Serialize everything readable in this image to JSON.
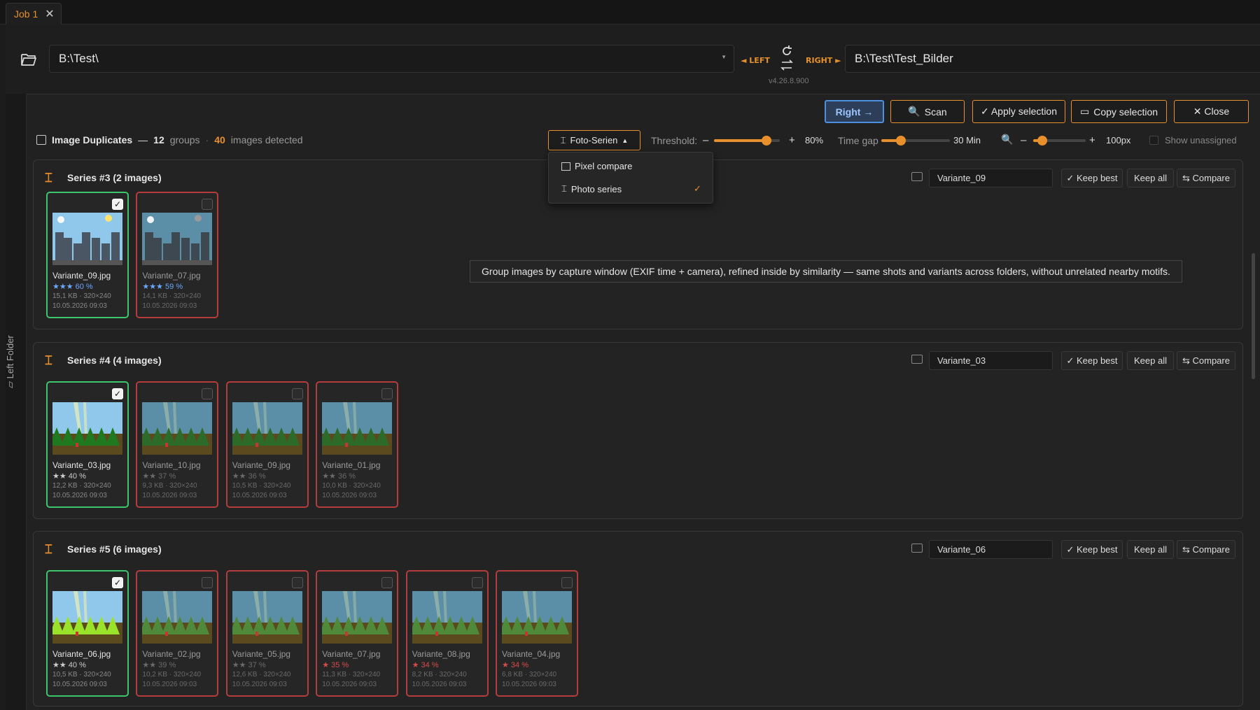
{
  "tab": {
    "label": "Job 1",
    "close": "✕"
  },
  "left_path": "B:\\Test\\",
  "left_label": "◄ LEFT",
  "right_label": "RIGHT ►",
  "right_path": "B:\\Test\\Test_Bilder",
  "version": "v4.26.8.900",
  "side_label": "Left Folder",
  "toolbar": {
    "direction": "Right →",
    "scan": "Scan",
    "apply": "✓ Apply selection",
    "copy": "Copy selection",
    "close": "✕ Close"
  },
  "summary": {
    "title": "Image Duplicates",
    "dash": "—",
    "groups_count": "12",
    "groups_label": "groups",
    "dot": "·",
    "images_count": "40",
    "images_label": "images detected"
  },
  "mode_select": {
    "value": "Foto-Serien"
  },
  "threshold": {
    "label": "Threshold:",
    "minus": "–",
    "plus": "+",
    "value": "80%",
    "fraction": 0.8
  },
  "timegap": {
    "label": "Time gap",
    "value": "30 Min"
  },
  "zoom": {
    "minus": "–",
    "plus": "+",
    "value": "100px"
  },
  "show_unassigned": "Show unassigned",
  "dropdown": {
    "items": [
      {
        "label": "Pixel compare"
      },
      {
        "label": "Photo series",
        "check": "✓"
      }
    ]
  },
  "tooltip": "Group images by capture window (EXIF time + camera), refined inside by similarity — same shots and variants across folders, without unrelated nearby motifs.",
  "group_buttons": {
    "keep_best": "✓ Keep best",
    "keep_all": "Keep all",
    "compare": "⇆ Compare"
  },
  "groups": [
    {
      "title": "Series #3 (2 images)",
      "name": "Variante_09",
      "thumbs": [
        {
          "file": "Variante_09.jpg",
          "rating": "★★★ 60 %",
          "size": "15,1 KB · 320×240",
          "date": "10.05.2026 09:03"
        },
        {
          "file": "Variante_07.jpg",
          "rating": "★★★ 59 %",
          "size": "14,1 KB · 320×240",
          "date": "10.05.2026 09:03"
        }
      ]
    },
    {
      "title": "Series #4 (4 images)",
      "name": "Variante_03",
      "thumbs": [
        {
          "file": "Variante_03.jpg",
          "rating": "★★ 40 %",
          "size": "12,2 KB · 320×240",
          "date": "10.05.2026 09:03"
        },
        {
          "file": "Variante_10.jpg",
          "rating": "★★ 37 %",
          "size": "9,3 KB · 320×240",
          "date": "10.05.2026 09:03"
        },
        {
          "file": "Variante_09.jpg",
          "rating": "★★ 36 %",
          "size": "10,5 KB · 320×240",
          "date": "10.05.2026 09:03"
        },
        {
          "file": "Variante_01.jpg",
          "rating": "★★ 36 %",
          "size": "10,0 KB · 320×240",
          "date": "10.05.2026 09:03"
        }
      ]
    },
    {
      "title": "Series #5 (6 images)",
      "name": "Variante_06",
      "thumbs": [
        {
          "file": "Variante_06.jpg",
          "rating": "★★ 40 %",
          "size": "10,5 KB · 320×240",
          "date": "10.05.2026 09:03"
        },
        {
          "file": "Variante_02.jpg",
          "rating": "★★ 39 %",
          "size": "10,2 KB · 320×240",
          "date": "10.05.2026 09:03"
        },
        {
          "file": "Variante_05.jpg",
          "rating": "★★ 37 %",
          "size": "12,6 KB · 320×240",
          "date": "10.05.2026 09:03"
        },
        {
          "file": "Variante_07.jpg",
          "rating": "★ 35 %",
          "size": "11,3 KB · 320×240",
          "date": "10.05.2026 09:03"
        },
        {
          "file": "Variante_08.jpg",
          "rating": "★ 34 %",
          "size": "8,2 KB · 320×240",
          "date": "10.05.2026 09:03"
        },
        {
          "file": "Variante_04.jpg",
          "rating": "★ 34 %",
          "size": "6,8 KB · 320×240",
          "date": "10.05.2026 09:03"
        }
      ]
    }
  ]
}
